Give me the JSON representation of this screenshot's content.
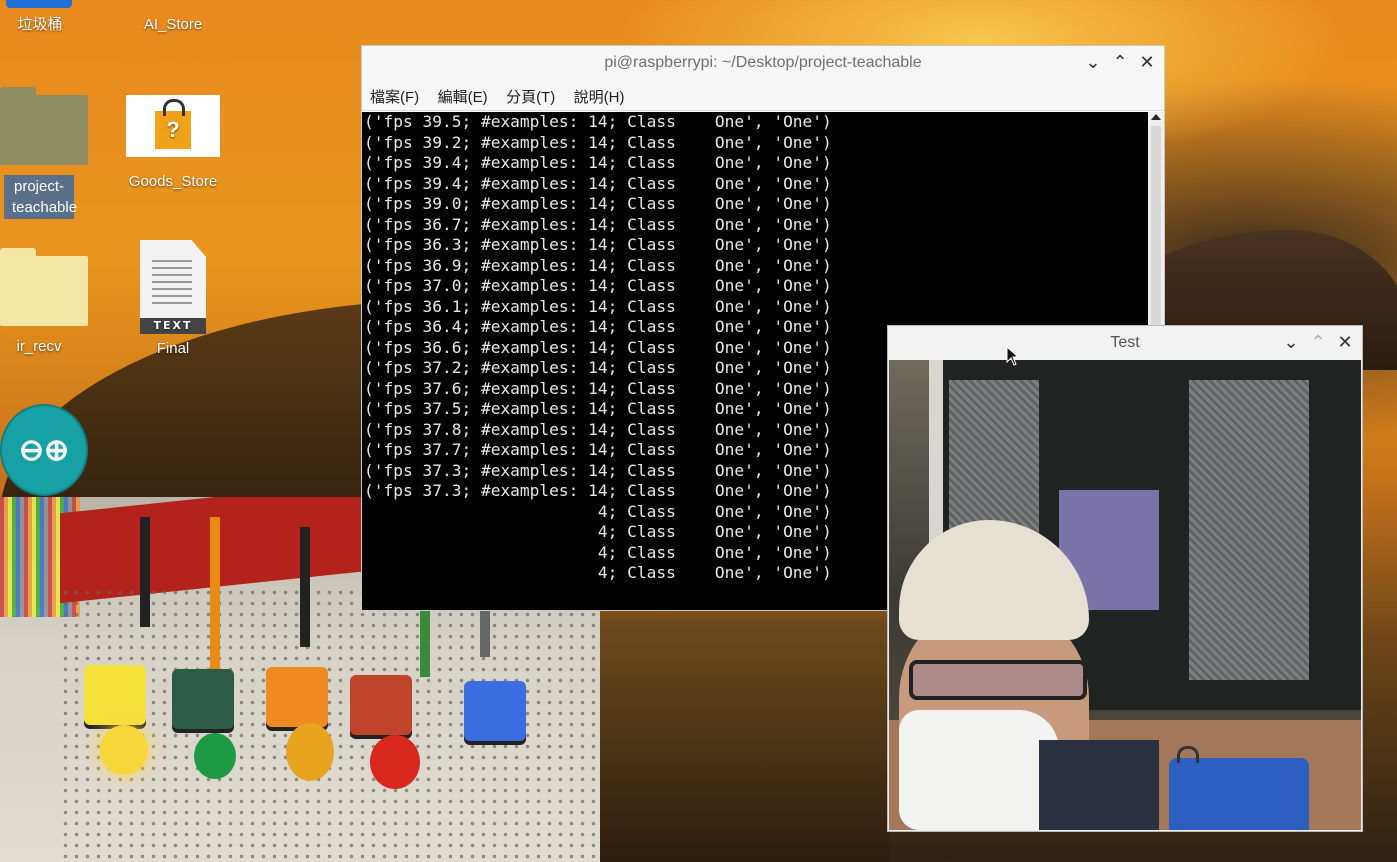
{
  "desktop": {
    "icons": {
      "trash": "垃圾桶",
      "ai_store": "AI_Store",
      "project": "project-\nteachable",
      "goods_store": "Goods_Store",
      "ir_recv": "ir_recv",
      "final": "Final",
      "text_tag": "TEXT"
    }
  },
  "terminal": {
    "title": "pi@raspberrypi: ~/Desktop/project-teachable",
    "menu": [
      "檔案(F)",
      "編輯(E)",
      "分頁(T)",
      "說明(H)"
    ],
    "lines": [
      "('fps 39.5; #examples: 14; Class    One', 'One')",
      "('fps 39.2; #examples: 14; Class    One', 'One')",
      "('fps 39.4; #examples: 14; Class    One', 'One')",
      "('fps 39.4; #examples: 14; Class    One', 'One')",
      "('fps 39.0; #examples: 14; Class    One', 'One')",
      "('fps 36.7; #examples: 14; Class    One', 'One')",
      "('fps 36.3; #examples: 14; Class    One', 'One')",
      "('fps 36.9; #examples: 14; Class    One', 'One')",
      "('fps 37.0; #examples: 14; Class    One', 'One')",
      "('fps 36.1; #examples: 14; Class    One', 'One')",
      "('fps 36.4; #examples: 14; Class    One', 'One')",
      "('fps 36.6; #examples: 14; Class    One', 'One')",
      "('fps 37.2; #examples: 14; Class    One', 'One')",
      "('fps 37.6; #examples: 14; Class    One', 'One')",
      "('fps 37.5; #examples: 14; Class    One', 'One')",
      "('fps 37.8; #examples: 14; Class    One', 'One')",
      "('fps 37.7; #examples: 14; Class    One', 'One')",
      "('fps 37.3; #examples: 14; Class    One', 'One')",
      "('fps 37.3; #examples: 14; Class    One', 'One')",
      "                        4; Class    One', 'One')",
      "                        4; Class    One', 'One')",
      "                        4; Class    One', 'One')",
      "                        4; Class    One', 'One')"
    ]
  },
  "test_window": {
    "title": "Test"
  },
  "window_controls": {
    "minimize": "⌄",
    "maximize": "⌃",
    "close": "✕"
  }
}
